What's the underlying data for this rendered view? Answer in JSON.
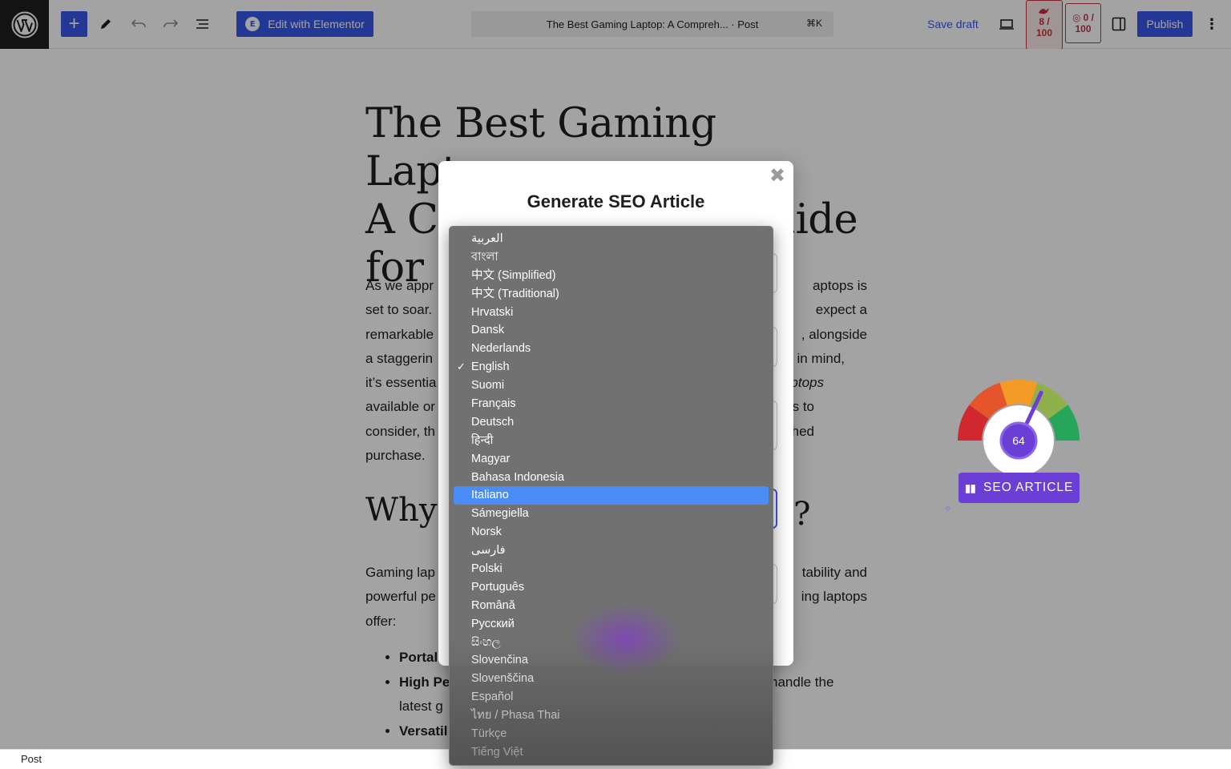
{
  "toolbar": {
    "elementor_label": "Edit with Elementor",
    "document_title": "The Best Gaming Laptop: A Compreh... · Post",
    "shortcut": "⌘K",
    "save_draft": "Save draft",
    "score1_top": "8 /",
    "score1_bottom": "100",
    "score2_top": "0 /",
    "score2_bottom": "100",
    "publish": "Publish"
  },
  "post": {
    "title_lines": [
      "The Best Gaming Laptop:",
      "A Comprehensive Guide",
      "for 2"
    ],
    "para1_left": [
      "As we appr",
      "set to soar.",
      "remarkable",
      "a staggerin",
      "it’s essentia",
      "available or",
      "consider, th",
      "purchase."
    ],
    "para1_right": [
      "aptops is",
      "expect a",
      ", alongside",
      "in mind,",
      "ptops",
      "s to",
      "hed"
    ],
    "heading_left": "Why",
    "heading_right": "?",
    "para2_left": [
      "Gaming lap",
      "powerful pe",
      "offer:"
    ],
    "para2_right": [
      "tability and",
      "ing laptops"
    ],
    "bullets": [
      {
        "left": "Portal",
        "right": ""
      },
      {
        "left": "High Pe",
        "right": "handle the"
      },
      {
        "left": "latest g",
        "right": ""
      },
      {
        "left": "Versatil",
        "right": ""
      }
    ]
  },
  "modal": {
    "title": "Generate SEO Article",
    "close": "✖"
  },
  "dropdown": {
    "options": [
      "العربية",
      "বাংলা",
      "中文 (Simplified)",
      "中文 (Traditional)",
      "Hrvatski",
      "Dansk",
      "Nederlands",
      "English",
      "Suomi",
      "Français",
      "Deutsch",
      "हिन्दी",
      "Magyar",
      "Bahasa Indonesia",
      "Italiano",
      "Sámegiella",
      "Norsk",
      "فارسی",
      "Polski",
      "Português",
      "Română",
      "Русский",
      "සිංහල",
      "Slovenčina",
      "Slovenščina",
      "Español",
      "ไทย / Phasa Thai",
      "Türkçe",
      "Tiếng Việt"
    ],
    "checked": "English",
    "highlighted": "Italiano"
  },
  "seo_widget": {
    "score": "64",
    "score_value": 64,
    "button_label": "SEO ARTICLE",
    "colors": [
      "#d0282e",
      "#e5542a",
      "#f49a26",
      "#8fb04a",
      "#26a65b"
    ]
  },
  "status": {
    "label": "Post"
  }
}
